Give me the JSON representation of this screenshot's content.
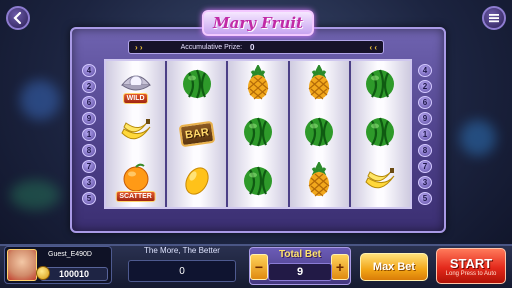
{
  "title": "Mary Fruit",
  "prize": {
    "label": "Accumulative Prize:",
    "value": "0",
    "arrows_left": "›  ›",
    "arrows_right": "‹  ‹"
  },
  "paylines_left": [
    "4",
    "2",
    "6",
    "9",
    "1",
    "8",
    "7",
    "3",
    "5"
  ],
  "paylines_right": [
    "4",
    "2",
    "6",
    "9",
    "1",
    "8",
    "7",
    "3",
    "5"
  ],
  "reels": [
    [
      {
        "icon": "pearl-icon",
        "tag": "WILD"
      },
      {
        "icon": "banana-icon",
        "tag": ""
      },
      {
        "icon": "orange-icon",
        "tag": "SCATTER"
      }
    ],
    [
      {
        "icon": "watermelon-icon",
        "tag": ""
      },
      {
        "icon": "bar-icon",
        "tag": "BAR"
      },
      {
        "icon": "mango-icon",
        "tag": ""
      }
    ],
    [
      {
        "icon": "pineapple-icon",
        "tag": ""
      },
      {
        "icon": "watermelon-icon",
        "tag": ""
      },
      {
        "icon": "watermelon-icon",
        "tag": ""
      }
    ],
    [
      {
        "icon": "pineapple-icon",
        "tag": ""
      },
      {
        "icon": "watermelon-icon",
        "tag": ""
      },
      {
        "icon": "pineapple-icon",
        "tag": ""
      }
    ],
    [
      {
        "icon": "watermelon-icon",
        "tag": ""
      },
      {
        "icon": "watermelon-icon",
        "tag": ""
      },
      {
        "icon": "banana-icon",
        "tag": ""
      }
    ]
  ],
  "player": {
    "name": "Guest_E490D",
    "coins": "100010"
  },
  "win": {
    "label": "The More, The Better",
    "value": "0"
  },
  "bet": {
    "label": "Total Bet",
    "value": "9",
    "minus": "−",
    "plus": "+"
  },
  "max_bet_label": "Max Bet",
  "start": {
    "label": "START",
    "sub": "Long Press to Auto"
  },
  "colors": {
    "accent": "#f2a516",
    "start": "#e42a1c",
    "frame": "#6f63b0"
  }
}
